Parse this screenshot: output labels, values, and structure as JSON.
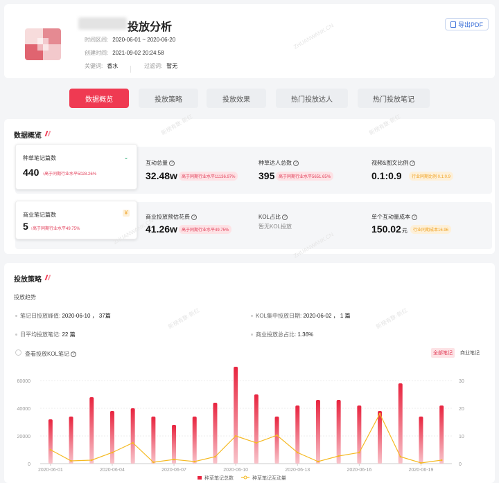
{
  "header": {
    "title": "投放分析",
    "meta": {
      "time_label": "时间区间:",
      "time_value": "2020-06-01 ~ 2020-06-20",
      "created_label": "创建时间:",
      "created_value": "2021-09-02 20:24:58",
      "keyword_label": "关键词:",
      "keyword_value": "香水",
      "filter_label": "过滤词:",
      "filter_value": "暂无"
    },
    "export_label": "导出PDF"
  },
  "tabs": [
    "数据概览",
    "投放策略",
    "投放效果",
    "热门投放达人",
    "热门投放笔记"
  ],
  "overview": {
    "title": "数据概览",
    "row1": {
      "card": {
        "label": "种草笔记篇数",
        "value": "440",
        "compare": "高于同期行业水平5028.26%"
      },
      "items": [
        {
          "label": "互动总量",
          "value": "32.48w",
          "compare": "高于同期行业水平11136.97%"
        },
        {
          "label": "种草达人总数",
          "value": "395",
          "compare": "高于同期行业水平5651.65%"
        },
        {
          "label": "视频&图文比例",
          "value": "0.1:0.9",
          "compare": "行业同期比例 0.1:0.9"
        }
      ]
    },
    "row2": {
      "card": {
        "label": "商业笔记篇数",
        "value": "5",
        "compare": "高于同期行业水平49.75%"
      },
      "items": [
        {
          "label": "商业投放预估花费",
          "value": "41.26w",
          "compare": "高于同期行业水平49.75%"
        },
        {
          "label": "KOL占比",
          "sub": "暂无KOL投放"
        },
        {
          "label": "单个互动量成本",
          "value": "150.02",
          "unit": "元",
          "compare": "行业同期成本16.96"
        }
      ]
    }
  },
  "strategy": {
    "title": "投放策略",
    "subtitle": "投放趋势",
    "stats": [
      {
        "label": "笔记日投放峰值:",
        "value": "2020-06-10 ， 37篇"
      },
      {
        "label": "KOL集中投放日期:",
        "value": "2020-06-02 ， 1 篇"
      },
      {
        "label": "日平均投放笔记:",
        "value": "22 篇"
      },
      {
        "label": "商业投放总占比:",
        "value": "1.36%"
      }
    ],
    "checkbox_label": "查看投放KOL笔记",
    "buttons": {
      "all": "全部笔记",
      "commercial": "商业笔记"
    }
  },
  "watermarks": [
    "ZHUANWANK.CN",
    "新榜有数·新红"
  ],
  "colors": {
    "accent": "#ef3a52",
    "line": "#f5b921",
    "export": "#3a6fd8"
  },
  "chart_data": {
    "type": "bar",
    "categories": [
      "2020-06-01",
      "2020-06-02",
      "2020-06-03",
      "2020-06-04",
      "2020-06-05",
      "2020-06-06",
      "2020-06-07",
      "2020-06-08",
      "2020-06-09",
      "2020-06-10",
      "2020-06-11",
      "2020-06-12",
      "2020-06-13",
      "2020-06-14",
      "2020-06-15",
      "2020-06-16",
      "2020-06-17",
      "2020-06-18",
      "2020-06-19",
      "2020-06-20"
    ],
    "x_tick_labels": [
      "2020-06-01",
      "2020-06-04",
      "2020-06-07",
      "2020-06-10",
      "2020-06-13",
      "2020-06-16",
      "2020-06-19"
    ],
    "series": [
      {
        "name": "种草笔记总数",
        "type": "bar",
        "axis": "right",
        "values": [
          16,
          17,
          24,
          19,
          20,
          17,
          14,
          17,
          22,
          35,
          25,
          17,
          21,
          23,
          23,
          21,
          19,
          29,
          17,
          21
        ]
      },
      {
        "name": "种草笔记互动量",
        "type": "line",
        "axis": "left",
        "values": [
          10000,
          2000,
          2500,
          8000,
          15000,
          1000,
          3000,
          1500,
          5000,
          20000,
          15000,
          20500,
          8000,
          1500,
          5500,
          8000,
          36000,
          5000,
          500,
          2500
        ]
      }
    ],
    "y_left": {
      "ticks": [
        0,
        20000,
        40000,
        60000
      ],
      "range": [
        0,
        75000
      ]
    },
    "y_right": {
      "ticks": [
        0,
        10,
        20,
        30
      ],
      "range": [
        0,
        37.5
      ]
    },
    "grid": true,
    "legend_position": "bottom"
  }
}
